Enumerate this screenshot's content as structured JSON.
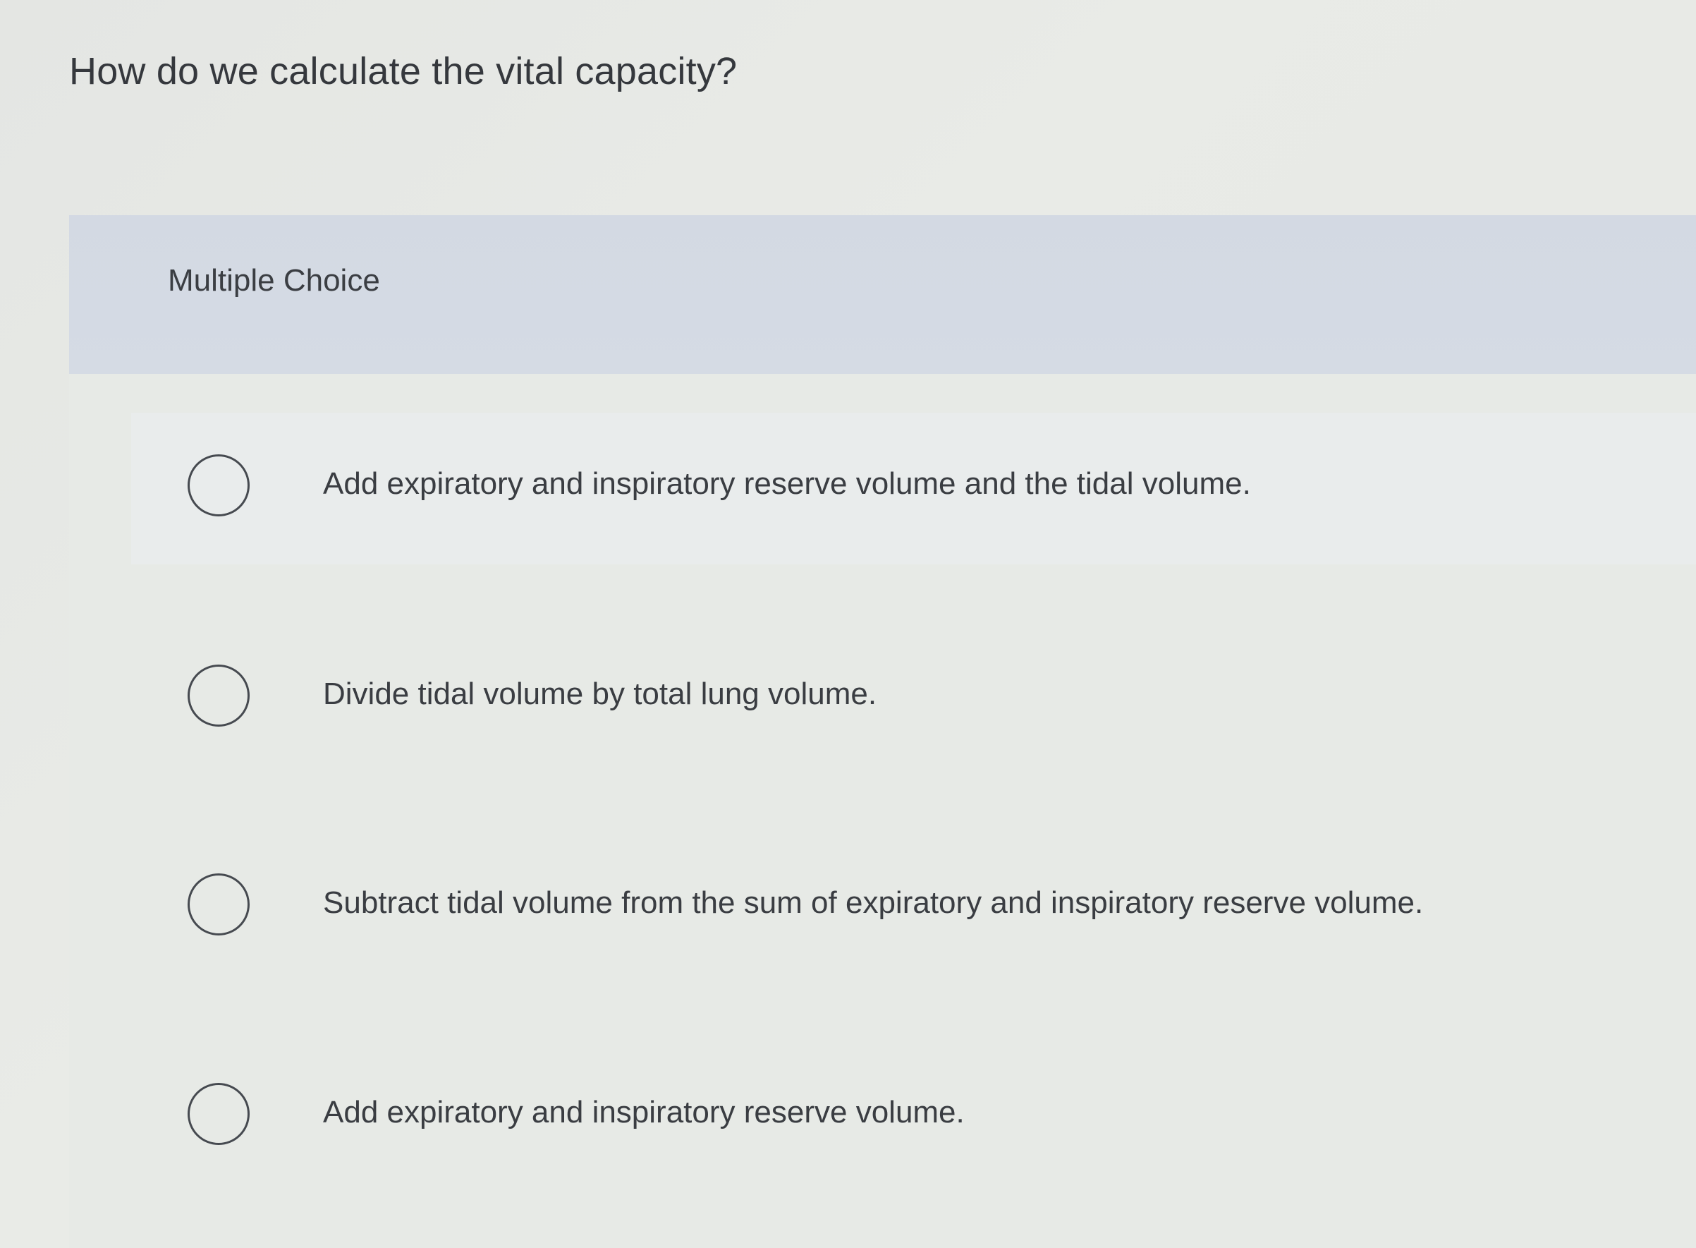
{
  "question": {
    "title": "How do we calculate the vital capacity?"
  },
  "card": {
    "header_label": "Multiple Choice"
  },
  "options": [
    {
      "label": "Add expiratory and inspiratory reserve volume and the tidal volume.",
      "selected": false
    },
    {
      "label": "Divide tidal volume by total lung volume.",
      "selected": false
    },
    {
      "label": "Subtract tidal volume from the sum of expiratory and inspiratory reserve volume.",
      "selected": false
    },
    {
      "label": "Add expiratory and inspiratory reserve volume.",
      "selected": false
    }
  ]
}
